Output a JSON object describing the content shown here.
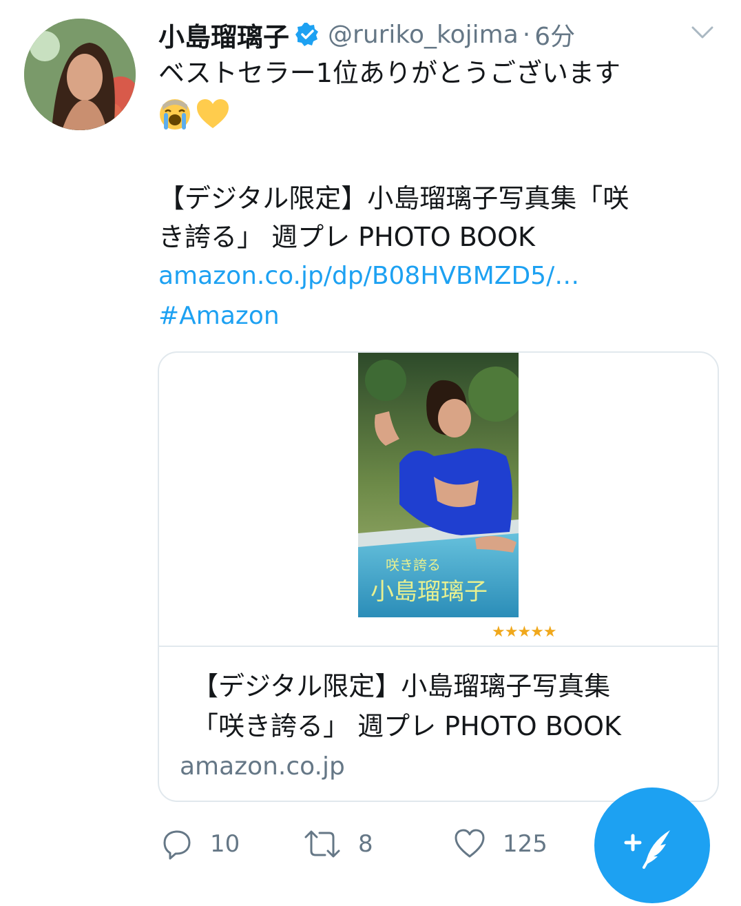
{
  "tweet": {
    "display_name": "小島瑠璃子",
    "handle": "@ruriko_kojima",
    "separator": "·",
    "time": "6分",
    "text_line1": "ベストセラー1位ありがとうございます",
    "emojis": [
      "crying-face",
      "yellow-heart"
    ],
    "body_line1": "【デジタル限定】小島瑠璃子写真集「咲",
    "body_line2": "き誇る」 週プレ PHOTO BOOK",
    "link": "amazon.co.jp/dp/B08HVBMZD5/…",
    "hashtag": "#Amazon"
  },
  "card": {
    "cover_small_text": "咲き誇る",
    "cover_big_text": "小島瑠璃子",
    "stars": "★★★★★",
    "title_line1": "【デジタル限定】小島瑠璃子写真集",
    "title_line2": "「咲き誇る」 週プレ PHOTO BOOK",
    "domain": "amazon.co.jp"
  },
  "actions": {
    "replies": "10",
    "retweets": "8",
    "likes": "125"
  },
  "colors": {
    "link": "#1da1f2",
    "muted": "#657786",
    "fab": "#1da1f2",
    "verified": "#1da1f2"
  }
}
